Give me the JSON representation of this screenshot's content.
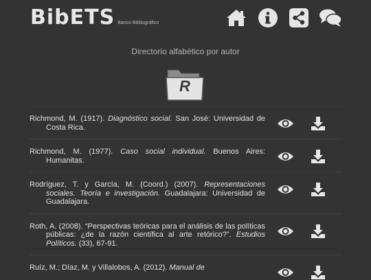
{
  "header": {
    "logo_text": "BibETS",
    "logo_subtitle": "Banco Bibliográfico",
    "icons": [
      "home-icon",
      "info-icon",
      "share-icon",
      "chat-icon"
    ]
  },
  "directory": {
    "title": "Directorio alfabético por autor",
    "letter": "R"
  },
  "entries": [
    {
      "pre": "Richmond, M. (1917). ",
      "title": "Diagnóstico social.",
      "post": " San José: Universidad de Costa Rica.",
      "view_icon": "eye-icon",
      "download_icon": "download-icon"
    },
    {
      "pre": "Richmond, M. (1977). ",
      "title": "Caso social individual.",
      "post": " Buenos Aires: Humanitas.",
      "view_icon": "eye-icon",
      "download_icon": "download-icon"
    },
    {
      "pre": "Rodríguez, T. y García, M. (Coord.) (2007). ",
      "title": "Representaciones sociales. Teoría e investigación.",
      "post": " Guadalajara: Universidad de Guadalajara.",
      "view_icon": "eye-icon",
      "download_icon": "download-icon"
    },
    {
      "pre": "Roth, A. (2008). “Perspectivas teóricas para el análisis de las políticas públicas: ¿de la razón científica al arte retórico?”. ",
      "title": "Estudios Políticos.",
      "post": " (33), 67-91.",
      "view_icon": "eye-icon",
      "download_icon": "download-icon"
    },
    {
      "pre": "Ruíz, M.; Díaz, M. y Villalobos, A. (2012). ",
      "title": "Manual de",
      "post": "",
      "view_icon": "eye-icon",
      "download_icon": "download-icon"
    }
  ],
  "colors": {
    "background": "#333333",
    "icon": "#e6e6e6",
    "text": "#e2e2e2"
  }
}
